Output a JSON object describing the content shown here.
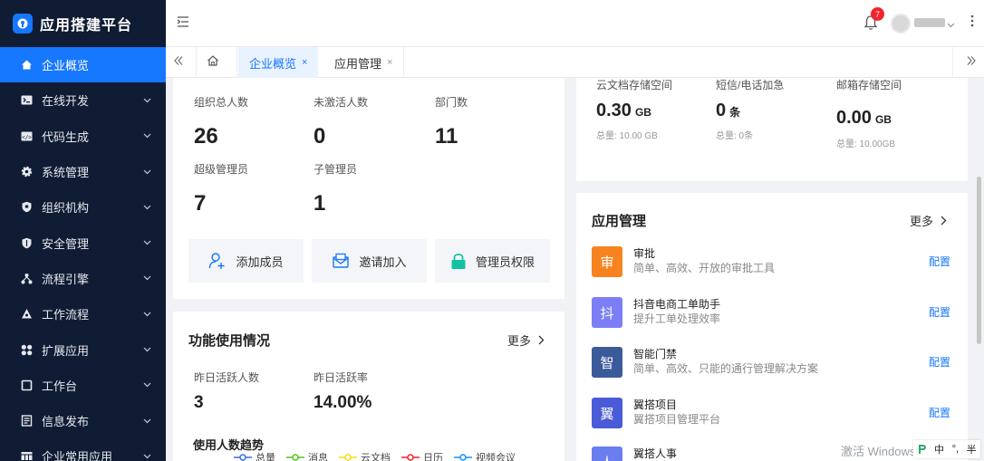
{
  "app": {
    "title": "应用搭建平台"
  },
  "sidebar": {
    "items": [
      {
        "label": "企业概览",
        "icon": "home-icon",
        "active": true
      },
      {
        "label": "在线开发",
        "icon": "terminal-icon"
      },
      {
        "label": "代码生成",
        "icon": "code-icon"
      },
      {
        "label": "系统管理",
        "icon": "gear-icon"
      },
      {
        "label": "组织机构",
        "icon": "shield-icon"
      },
      {
        "label": "安全管理",
        "icon": "security-shield-icon"
      },
      {
        "label": "流程引擎",
        "icon": "flow-icon"
      },
      {
        "label": "工作流程",
        "icon": "workflow-icon"
      },
      {
        "label": "扩展应用",
        "icon": "grid-icon"
      },
      {
        "label": "工作台",
        "icon": "desk-icon"
      },
      {
        "label": "信息发布",
        "icon": "news-icon"
      },
      {
        "label": "企业常用应用",
        "icon": "apps-icon"
      }
    ]
  },
  "header": {
    "badge_count": "7"
  },
  "tabs": [
    {
      "label": "企业概览",
      "close": "×",
      "active": true
    },
    {
      "label": "应用管理",
      "close": "×"
    }
  ],
  "org_stats": {
    "total_label": "组织总人数",
    "total_value": "26",
    "inactive_label": "未激活人数",
    "inactive_value": "0",
    "dept_label": "部门数",
    "dept_value": "11",
    "super_label": "超级管理员",
    "super_value": "7",
    "sub_label": "子管理员",
    "sub_value": "1"
  },
  "actions": {
    "add_member": "添加成员",
    "invite": "邀请加入",
    "admin_perm": "管理员权限"
  },
  "usage": {
    "title": "功能使用情况",
    "more": "更多",
    "active_label": "昨日活跃人数",
    "active_value": "3",
    "rate_label": "昨日活跃率",
    "rate_value": "14.00%",
    "trend_title": "使用人数趋势",
    "legend": [
      "总量",
      "消息",
      "云文档",
      "日历",
      "视频会议"
    ],
    "legend_colors": [
      "#3b6fe0",
      "#52c41a",
      "#fadb14",
      "#f5222d",
      "#1890ff"
    ]
  },
  "storage": {
    "cloud_label": "云文档存储空间",
    "cloud_value": "0.30",
    "cloud_unit": "GB",
    "cloud_total": "总量: 10.00 GB",
    "sms_label": "短信/电话加急",
    "sms_value": "0",
    "sms_unit": "条",
    "sms_total": "总量: 0条",
    "mail_label": "邮箱存储空间",
    "mail_value": "0.00",
    "mail_unit": "GB",
    "mail_total": "总量: 10.00GB"
  },
  "app_mgmt": {
    "title": "应用管理",
    "more": "更多",
    "config": "配置",
    "apps": [
      {
        "glyph": "审",
        "name": "审批",
        "desc": "简单、高效、开放的审批工具",
        "color": "#f7831f"
      },
      {
        "glyph": "抖",
        "name": "抖音电商工单助手",
        "desc": "提升工单处理效率",
        "color": "#7b7ef5"
      },
      {
        "glyph": "智",
        "name": "智能门禁",
        "desc": "简单、高效、只能的通行管理解决方案",
        "color": "#3b5a9a"
      },
      {
        "glyph": "翼",
        "name": "翼搭项目",
        "desc": "翼搭项目管理平台",
        "color": "#4a5bd8"
      },
      {
        "glyph": "人",
        "name": "翼搭人事",
        "desc": "",
        "color": "#6a7ef0"
      }
    ]
  },
  "os": {
    "watermark": "激活 Windows",
    "ime": [
      "中",
      "°,",
      "半"
    ]
  }
}
